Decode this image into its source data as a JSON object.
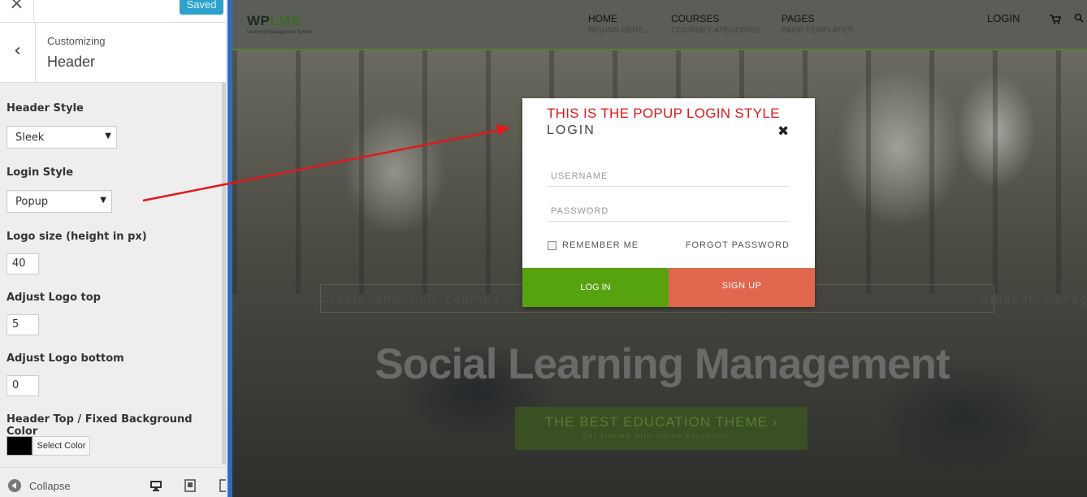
{
  "colors": {
    "saved_button": "#2ea2cc",
    "login_button": "#57a20f",
    "signup_button": "#e0674d",
    "annotation": "#e0181c",
    "logo_accent": "#3c6b22",
    "color_swatch": "#000000"
  },
  "customizer": {
    "close_icon": "close-icon",
    "saved_label": "Saved",
    "back_icon": "chevron-left-icon",
    "breadcrumb": "Customizing",
    "section_title": "Header",
    "controls": {
      "header_style": {
        "label": "Header Style",
        "value": "Sleek"
      },
      "login_style": {
        "label": "Login Style",
        "value": "Popup"
      },
      "logo_size": {
        "label": "Logo size (height in px)",
        "value": "40"
      },
      "logo_top": {
        "label": "Adjust Logo top",
        "value": "5"
      },
      "logo_bottom": {
        "label": "Adjust Logo bottom",
        "value": "0"
      },
      "bg_color": {
        "label": "Header Top / Fixed Background Color",
        "button": "Select Color"
      }
    },
    "footer": {
      "collapse_label": "Collapse",
      "devices": [
        "desktop-icon",
        "tablet-icon",
        "mobile-icon"
      ]
    }
  },
  "preview": {
    "logo": {
      "part1": "WP",
      "part2": "LMS",
      "tagline": "Learning Management System"
    },
    "nav": [
      {
        "label": "HOME",
        "sub": "BEGINS HERE..."
      },
      {
        "label": "COURSES",
        "sub": "COURSE CATEGORIES"
      },
      {
        "label": "PAGES",
        "sub": "PAGE TEMPLATES"
      }
    ],
    "login_link": "LOGIN",
    "hero": {
      "tagline": "Create and Sell courses                                                     Student Management",
      "title": "Social Learning Management",
      "cta_main": "THE BEST EDUCATION THEME ›",
      "cta_sub": "Get started with online educaiton...."
    }
  },
  "popup": {
    "annotation": "THIS IS THE POPUP LOGIN STYLE",
    "title": "LOGIN",
    "username_placeholder": "USERNAME",
    "password_placeholder": "PASSWORD",
    "remember_label": "REMEMBER ME",
    "forgot_label": "FORGOT PASSWORD",
    "login_button": "LOG IN",
    "signup_button": "SIGN UP"
  }
}
